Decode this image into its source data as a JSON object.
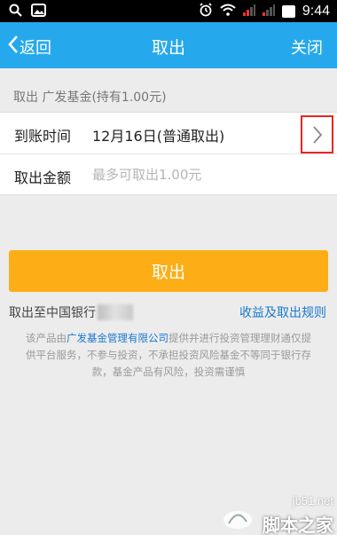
{
  "status_bar": {
    "time": "9:44",
    "left_icons": [
      "search-icon",
      "image-icon"
    ],
    "right_icons": [
      "alarm-icon",
      "wifi-icon",
      "signal-icon",
      "signal-icon",
      "battery-icon"
    ]
  },
  "nav": {
    "back_label": "返回",
    "title": "取出",
    "close_label": "关闭",
    "color": "#26a8ed"
  },
  "fund": {
    "summary": "取出 广发基金(持有1.00元)"
  },
  "form": {
    "arrival_label": "到账时间",
    "arrival_value": "12月16日(普通取出)",
    "amount_label": "取出金额",
    "amount_value": "",
    "amount_placeholder": "最多可取出1.00元"
  },
  "withdraw_button": {
    "label": "取出",
    "color": "#fdae16"
  },
  "bank": {
    "label": "取出至中国银行",
    "rules_link": "收益及取出规则"
  },
  "disclaimer": {
    "prefix": "该产品由",
    "company": "广发基金管理有限公司",
    "suffix": "提供并进行投资管理理财通仅提供平台服务，不参与投资，不承担投资风险基金不等同于银行存款，基金产品有风险，投资需谨慎"
  },
  "watermark": {
    "site": "jb51.net",
    "brand": "脚本之家"
  }
}
